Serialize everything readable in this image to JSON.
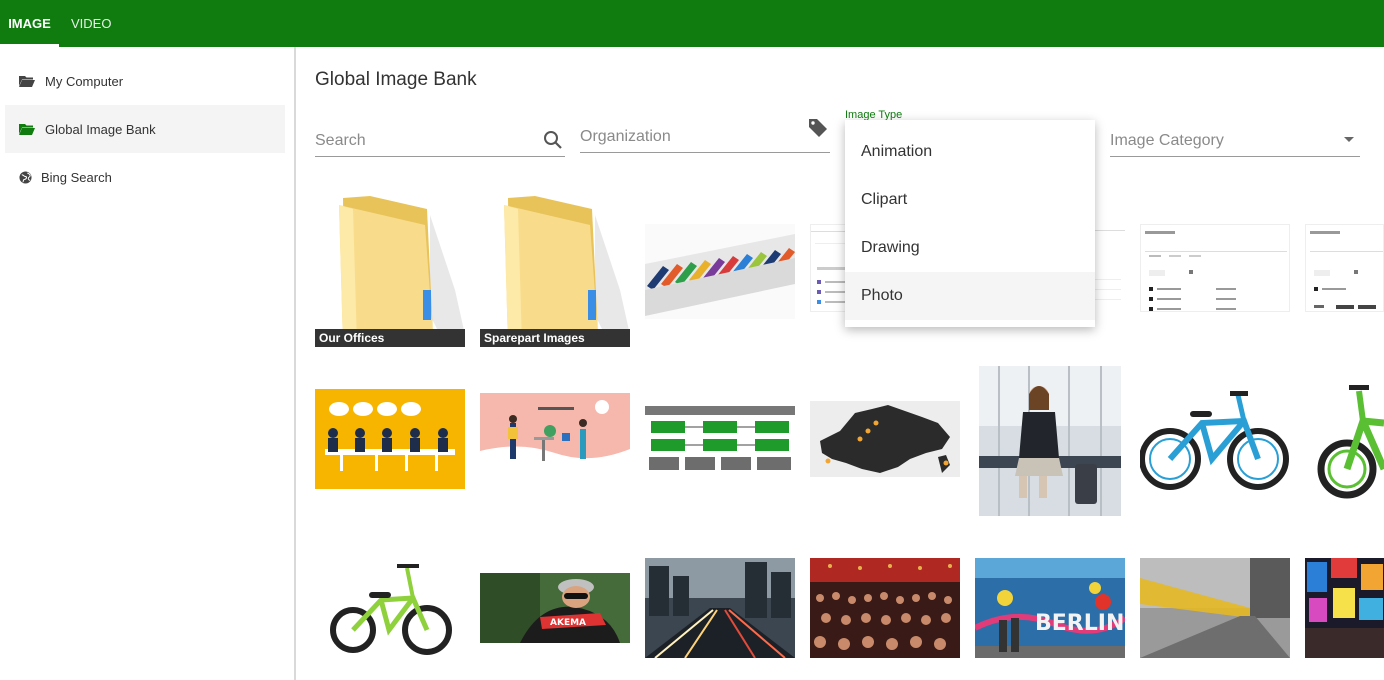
{
  "topbar": {
    "tabs": [
      {
        "label": "IMAGE"
      },
      {
        "label": "VIDEO"
      }
    ],
    "color": "#107c10"
  },
  "sidebar": {
    "items": [
      {
        "label": "My Computer",
        "icon": "folder-open-icon"
      },
      {
        "label": "Global Image Bank",
        "icon": "folder-open-icon",
        "active": true
      },
      {
        "label": "Bing Search",
        "icon": "globe-icon"
      }
    ]
  },
  "main": {
    "title": "Global Image Bank",
    "filters": {
      "search": {
        "placeholder": "Search",
        "icon": "search-icon"
      },
      "organization": {
        "placeholder": "Organization",
        "icon": "tag-icon"
      },
      "image_type": {
        "label": "Image Type",
        "options": [
          "Animation",
          "Clipart",
          "Drawing",
          "Photo"
        ],
        "highlighted": "Photo"
      },
      "image_category": {
        "placeholder": "Image Category",
        "icon": "chevron-down-icon"
      }
    },
    "gallery": [
      {
        "kind": "folder",
        "caption": "Our Offices"
      },
      {
        "kind": "folder",
        "caption": "Sparepart Images"
      },
      {
        "kind": "image",
        "subject": "books"
      },
      {
        "kind": "image",
        "subject": "site-directory-screenshot"
      },
      {
        "kind": "image",
        "subject": "site-directory-screenshot"
      },
      {
        "kind": "image",
        "subject": "site-directory-screenshot"
      },
      {
        "kind": "image",
        "subject": "site-directory-screenshot"
      },
      {
        "kind": "image",
        "subject": "meeting-illustration"
      },
      {
        "kind": "image",
        "subject": "office-illustration"
      },
      {
        "kind": "image",
        "subject": "process-diagram"
      },
      {
        "kind": "image",
        "subject": "europe-map"
      },
      {
        "kind": "image",
        "subject": "businesswoman-airport"
      },
      {
        "kind": "image",
        "subject": "blue-bicycle"
      },
      {
        "kind": "image",
        "subject": "green-bicycle"
      },
      {
        "kind": "image",
        "subject": "green-bmx-bike"
      },
      {
        "kind": "image",
        "subject": "cyclist"
      },
      {
        "kind": "image",
        "subject": "city-night-traffic"
      },
      {
        "kind": "image",
        "subject": "auditorium"
      },
      {
        "kind": "image",
        "subject": "berlin-wall"
      },
      {
        "kind": "image",
        "subject": "motion-blur-street"
      },
      {
        "kind": "image",
        "subject": "times-square"
      }
    ]
  }
}
